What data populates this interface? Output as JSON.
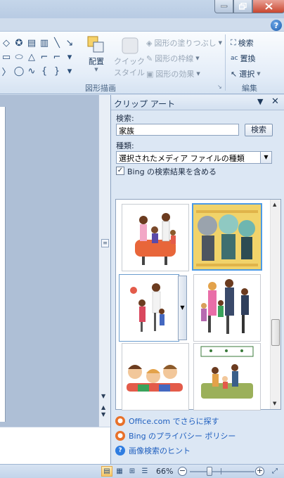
{
  "window": {
    "minimize_icon": "minimize-icon",
    "restore_icon": "restore-icon",
    "close_icon": "close-icon",
    "help_label": "?"
  },
  "ribbon": {
    "drawing_group": {
      "label": "図形描画",
      "arrange_label": "配置",
      "quick_styles_label_1": "クイック",
      "quick_styles_label_2": "スタイル",
      "shape_fill_label": "図形の塗りつぶし",
      "shape_outline_label": "図形の枠線",
      "shape_effects_label": "図形の効果"
    },
    "editing_group": {
      "label": "編集",
      "find_label": "検索",
      "replace_label": "置換",
      "select_label": "選択"
    }
  },
  "task_pane": {
    "title": "クリップ アート",
    "search_label": "検索:",
    "search_value": "家族",
    "search_button": "検索",
    "type_label": "種類:",
    "type_value": "選択されたメディア ファイルの種類",
    "bing_checkbox_label": "Bing の検索結果を含める",
    "bing_checked": true,
    "results": [
      {
        "name": "family-clipart-1"
      },
      {
        "name": "family-clipart-2"
      },
      {
        "name": "family-clipart-3"
      },
      {
        "name": "family-clipart-4"
      },
      {
        "name": "family-clipart-5"
      },
      {
        "name": "family-clipart-6"
      }
    ],
    "links": [
      {
        "label": "Office.com でさらに探す",
        "icon": "office-icon"
      },
      {
        "label": "Bing のプライバシー ポリシー",
        "icon": "bing-icon"
      },
      {
        "label": "画像検索のヒント",
        "icon": "help-icon"
      }
    ]
  },
  "status_bar": {
    "zoom": "66%",
    "zoom_fraction": 0.33,
    "accent": "#f7c867"
  }
}
